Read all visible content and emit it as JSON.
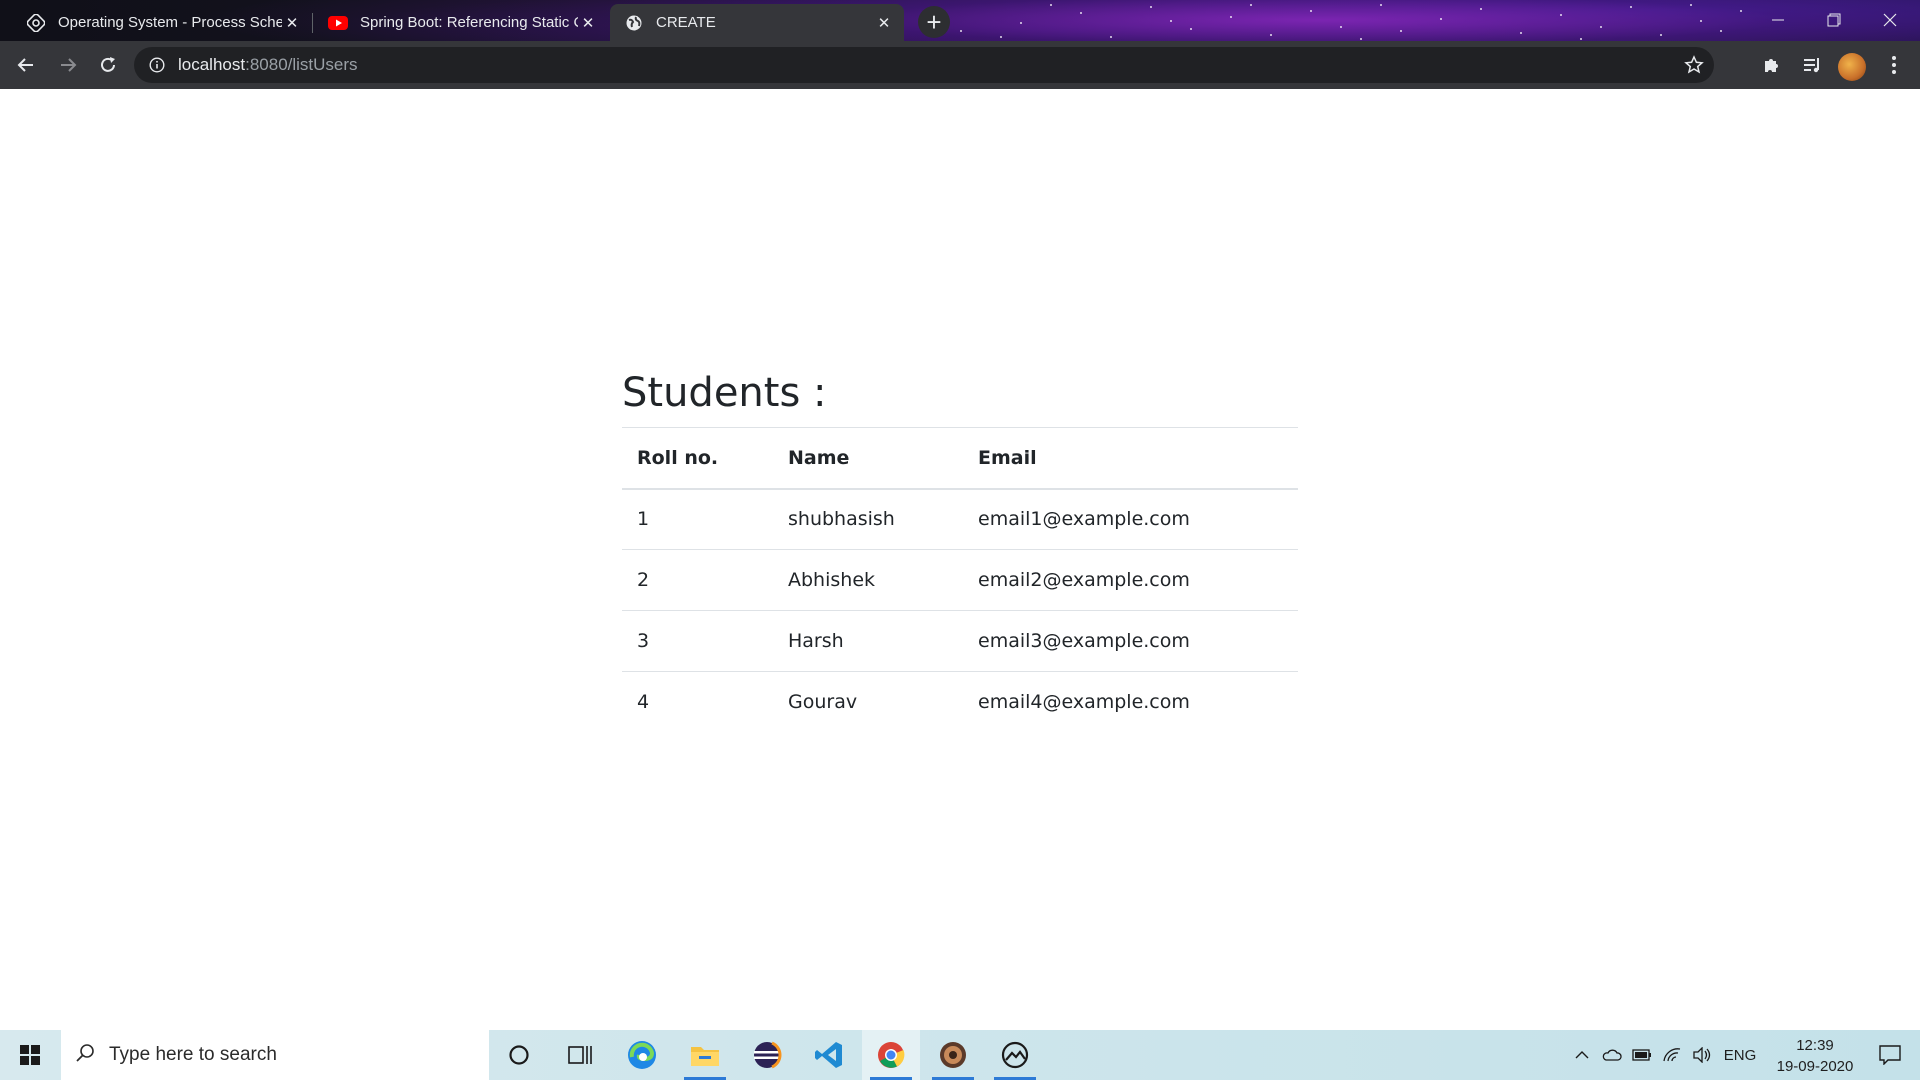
{
  "browser": {
    "tabs": [
      {
        "title": "Operating System - Process Sche",
        "favicon": "globe-gear-icon"
      },
      {
        "title": "Spring Boot: Referencing Static C",
        "favicon": "youtube-icon"
      },
      {
        "title": "CREATE",
        "favicon": "globe-icon"
      }
    ],
    "active_tab": 2,
    "address": {
      "host": "localhost",
      "path": ":8080/listUsers"
    },
    "colors": {
      "frame": "#161425",
      "toolbar": "#35363a",
      "omnibox": "#202124"
    }
  },
  "page": {
    "heading": "Students :",
    "table": {
      "columns": [
        "Roll no.",
        "Name",
        "Email"
      ],
      "rows": [
        [
          "1",
          "shubhasish",
          "email1@example.com"
        ],
        [
          "2",
          "Abhishek",
          "email2@example.com"
        ],
        [
          "3",
          "Harsh",
          "email3@example.com"
        ],
        [
          "4",
          "Gourav",
          "email4@example.com"
        ]
      ]
    }
  },
  "taskbar": {
    "search_placeholder": "Type here to search",
    "language": "ENG",
    "time": "12:39",
    "date": "19-09-2020",
    "apps": [
      "cortana-icon",
      "task-view-icon",
      "edge-icon",
      "file-explorer-icon",
      "eclipse-icon",
      "vscode-icon",
      "chrome-icon",
      "app-badge-icon",
      "photos-icon"
    ]
  }
}
